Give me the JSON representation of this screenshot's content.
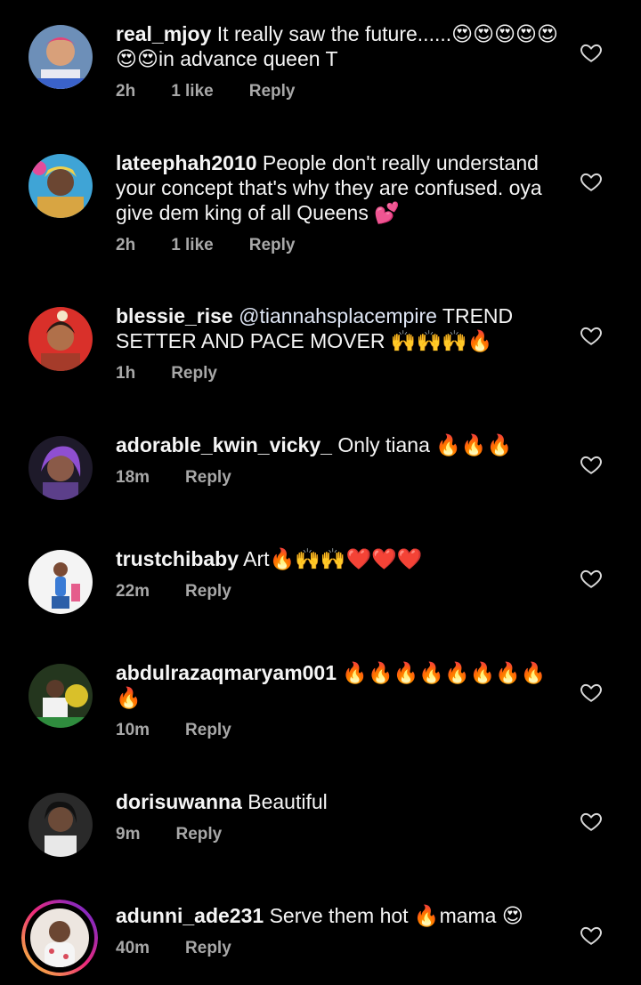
{
  "colors": {
    "background": "#000000",
    "text": "#f5f5f5",
    "meta": "#a8a8a8"
  },
  "comments": [
    {
      "username": "real_mjoy",
      "text": "It really saw the future......😍😍😍😍😍😍😍in advance queen T",
      "time": "2h",
      "likes": "1 like",
      "reply": "Reply",
      "avatar_icon": "avatar-pink-headwrap",
      "like_icon": "heart-outline"
    },
    {
      "username": "lateephah2010",
      "text": "People don't really understand your concept that's why they are confused. oya give dem king of all Queens 💕",
      "time": "2h",
      "likes": "1 like",
      "reply": "Reply",
      "avatar_icon": "avatar-colorful",
      "like_icon": "heart-outline"
    },
    {
      "username": "blessie_rise",
      "mention": "@tiannahsplacempire",
      "text": "TREND SETTER AND PACE MOVER 🙌🙌🙌🔥",
      "time": "1h",
      "reply": "Reply",
      "avatar_icon": "avatar-red-background",
      "like_icon": "heart-outline"
    },
    {
      "username": "adorable_kwin_vicky_",
      "text": "Only tiana 🔥🔥🔥",
      "time": "18m",
      "reply": "Reply",
      "avatar_icon": "avatar-purple-hair",
      "like_icon": "heart-outline"
    },
    {
      "username": "trustchibaby",
      "text": "Art🔥🙌🙌❤️❤️❤️",
      "time": "22m",
      "reply": "Reply",
      "avatar_icon": "avatar-white-background",
      "like_icon": "heart-outline"
    },
    {
      "username": "abdulrazaqmaryam001",
      "text": "🔥🔥🔥🔥🔥🔥🔥🔥🔥",
      "time": "10m",
      "reply": "Reply",
      "avatar_icon": "avatar-green-yellow",
      "like_icon": "heart-outline"
    },
    {
      "username": "dorisuwanna",
      "text": "Beautiful",
      "time": "9m",
      "reply": "Reply",
      "avatar_icon": "avatar-dark",
      "like_icon": "heart-outline"
    },
    {
      "username": "adunni_ade231",
      "text": "Serve them hot 🔥mama 😍",
      "time": "40m",
      "reply": "Reply",
      "avatar_icon": "avatar-story-ring",
      "like_icon": "heart-outline"
    }
  ]
}
